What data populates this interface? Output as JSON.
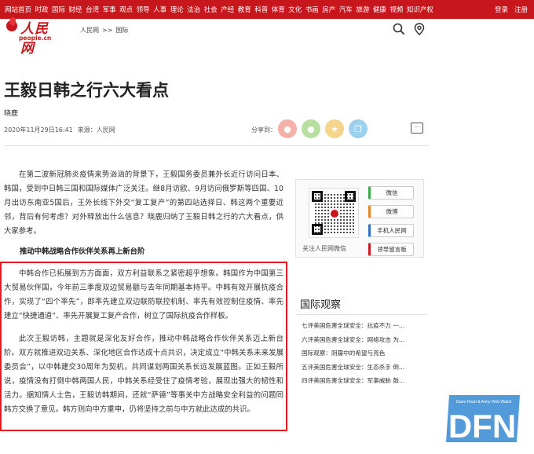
{
  "topnav": {
    "items": [
      "网站首页",
      "时政",
      "国际",
      "财经",
      "台湾",
      "军事",
      "观点",
      "领导",
      "人事",
      "理论",
      "法治",
      "社会",
      "产经",
      "教育",
      "科普",
      "体育",
      "文化",
      "书画",
      "房产",
      "汽车",
      "旅游",
      "健康",
      "视频",
      "知识产权"
    ],
    "login": "登录",
    "register": "注册"
  },
  "logo": {
    "name": "人民网",
    "url": "people.cn"
  },
  "breadcrumb": {
    "home": "人民网",
    "sep": ">>",
    "section": "国际"
  },
  "article": {
    "title": "王毅日韩之行六大看点",
    "author": "晓鹿",
    "datetime": "2020年11月29日16:41",
    "source": "来源：人民网",
    "share_label": "分享到：",
    "para1": "在第二波新冠肺炎疫情来势汹汹的背景下，王毅国务委员兼外长近行访问日本、韩国，受到中日韩三国和国际媒体广泛关注。继8月访欧、9月访问俄罗斯等四国、10月出访东南亚5国后，王外长线下外交“复工复产”的第四站选择日、韩这两个重要近邻，背后有何考虑？对外释放出什么信息？晓鹿归纳了王毅日韩之行的六大看点，供大家参考。",
    "subhead": "推动中韩战略合作伙伴关系再上新台阶",
    "para2": "中韩合作已拓展到方方面面，双方利益联系之紧密超乎想象。韩国作为中国第三大贸易伙伴国，今年前三季度双边贸易额与去年同期基本持平。中韩有效开展抗疫合作，实现了“四个率先”，即率先建立双边联防联控机制、率先有效控制住疫情、率先建立“快捷通道”、率先开展复工复产合作，树立了国际抗疫合作样板。",
    "para3": "此次王毅访韩，主题就是深化友好合作，推动中韩战略合作伙伴关系迈上新台阶。双方就推进双边关系、深化地区合作达成十点共识，决定成立“中韩关系未来发展委员会”，以中韩建交30周年为契机，共同谋划两国关系长远发展蓝图。正如王毅所说，疫情没有打倒中韩两国人民，中韩关系经受住了疫情考验，展现出强大的韧性和活力。据知情人士告，王毅访韩期间，还就“萨德”等事关中方战略安全利益的问题同韩方交换了意见。韩方则向中方重申，仍将坚持之前与中方就此达成的共识。"
  },
  "sidebar": {
    "qr_label": "关注人民网微信",
    "buttons": [
      "微信",
      "微博",
      "手机人民网",
      "领导留言板"
    ]
  },
  "guoji": {
    "title": "国际观察",
    "items": [
      "七评美国危害全球安全：抗疫不力 一...",
      "六评美国危害全球安全：网络攻击 为...",
      "国际观察：阴霾中的希望与亮色",
      "五评美国危害全球安全：生态杀手 倒...",
      "四评美国危害全球安全：军事威胁 鼓..."
    ]
  },
  "watermark": {
    "text": "DFN",
    "tagline": "Dawn Heart & Army Web Watch"
  },
  "colors": {
    "brand_red": "#c8161d",
    "highlight_box": "#e21a22"
  }
}
